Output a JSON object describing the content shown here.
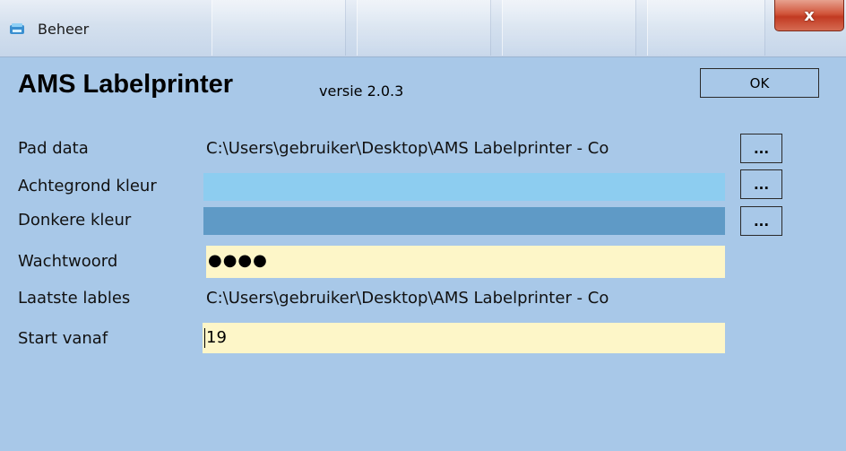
{
  "window": {
    "title": "Beheer",
    "close_glyph": "x",
    "icon": "app-icon"
  },
  "header": {
    "app_name": "AMS Labelprinter",
    "version": "versie 2.0.3",
    "ok_label": "OK"
  },
  "fields": {
    "pad_data": {
      "label": "Pad data",
      "value": "C:\\Users\\gebruiker\\Desktop\\AMS Labelprinter - Co",
      "browse": "..."
    },
    "achtergrond_kleur": {
      "label": "Achtegrond kleur",
      "color": "#8dcdf0",
      "browse": "..."
    },
    "donkere_kleur": {
      "label": "Donkere kleur",
      "color": "#5f9ac6",
      "browse": "..."
    },
    "wachtwoord": {
      "label": "Wachtwoord",
      "value": "●●●●"
    },
    "laatste_lables": {
      "label": "Laatste lables",
      "value": "C:\\Users\\gebruiker\\Desktop\\AMS Labelprinter - Co"
    },
    "start_vanaf": {
      "label": "Start vanaf",
      "value": "19"
    }
  },
  "colors": {
    "background": "#a8c8e8",
    "input_yellow": "#fdf6c8",
    "close_red": "#c23a22"
  }
}
